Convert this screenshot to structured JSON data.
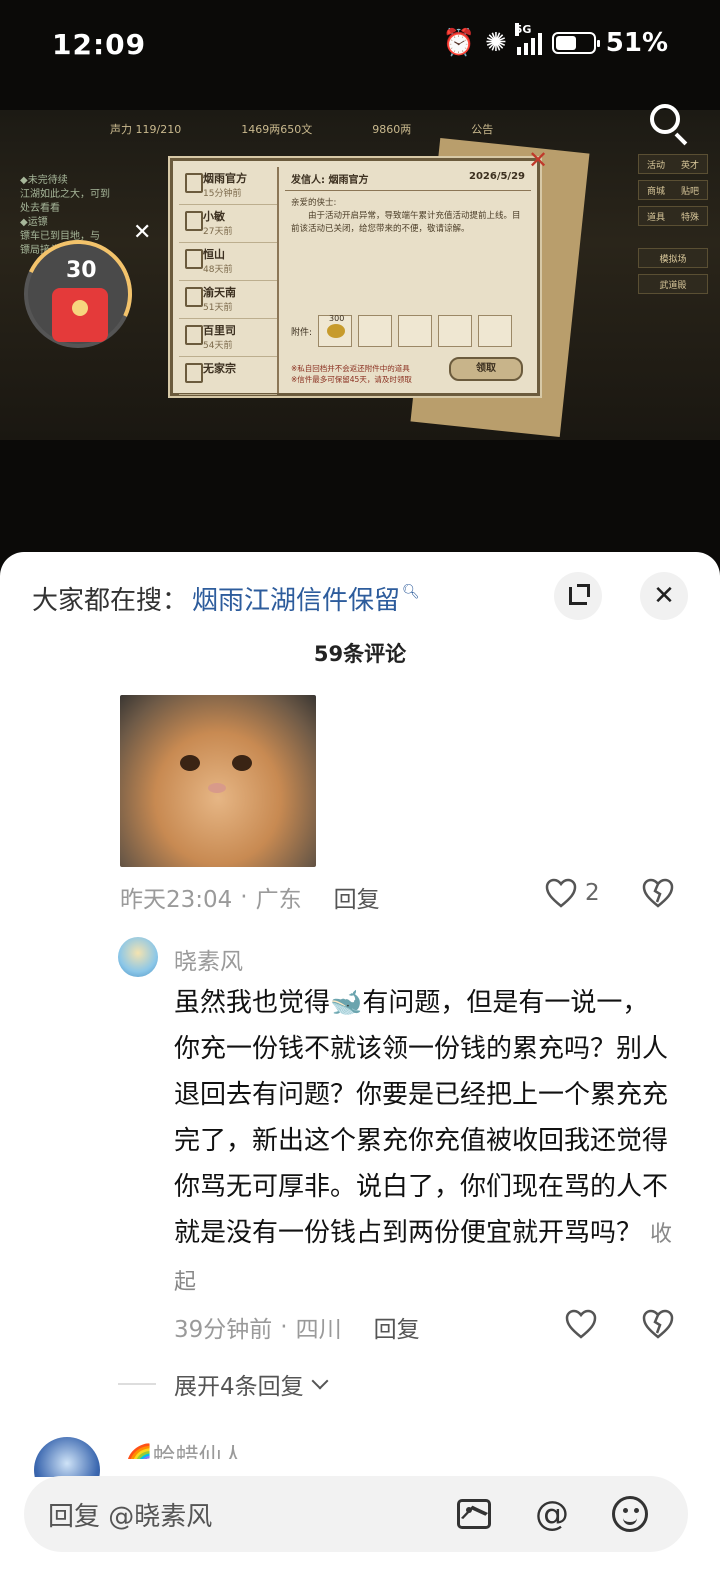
{
  "status_bar": {
    "time": "12:09",
    "network": "5G",
    "battery": "51%"
  },
  "game": {
    "topbar": [
      "声力 119/210",
      "1469两650文",
      "9860两",
      "公告"
    ],
    "left_info": [
      "◆未完待续",
      "江湖如此之大，可到",
      "处去看看",
      "◆运镖",
      "镖车已到目地，与",
      "镖局接头"
    ],
    "right_menu": [
      [
        "活动",
        "英才"
      ],
      [
        "商城",
        "贴吧"
      ],
      [
        "道具",
        "特殊"
      ],
      [
        "模拟场",
        ""
      ],
      [
        "武道殿",
        ""
      ]
    ],
    "mail_list": [
      {
        "name": "烟雨官方",
        "time": "15分钟前"
      },
      {
        "name": "小敏",
        "time": "27天前"
      },
      {
        "name": "恒山",
        "time": "48天前"
      },
      {
        "name": "渝天南",
        "time": "51天前"
      },
      {
        "name": "百里司",
        "time": "54天前"
      },
      {
        "name": "无家宗",
        "time": ""
      }
    ],
    "sender_label": "发信人: 烟雨官方",
    "date": "2026/5/29",
    "greeting": "亲爱的侠士:",
    "body": "由于活动开启异常，导致端午累计充值活动提前上线。目前该活动已关闭，给您带来的不便，敬请谅解。",
    "attachment_label": "附件:",
    "attachment_count": "300",
    "notes": [
      "※私自回档并不会返还附件中的道具",
      "※信件最多可保留45天，请及时领取"
    ],
    "claim_label": "领取",
    "red_envelope_count": "30"
  },
  "sheet": {
    "hot_search_prefix": "大家都在搜：",
    "hot_search_keyword": "烟雨江湖信件保留",
    "comment_count": "59条评论",
    "comment1": {
      "time": "昨天23:04",
      "location": "广东",
      "reply": "回复",
      "likes": "2"
    },
    "comment2": {
      "user": "晓素风",
      "text": "虽然我也觉得🐋有问题，但是有一说一，你充一份钱不就该领一份钱的累充吗？别人退回去有问题？你要是已经把上一个累充充完了，新出这个累充你充值被收回我还觉得你骂无可厚非。说白了，你们现在骂的人不就是没有一份钱占到两份便宜就开骂吗？",
      "fold": "收起",
      "time": "39分钟前",
      "location": "四川",
      "reply": "回复"
    },
    "expand_replies": "展开4条回复",
    "next_user": "🌈蛤蜡仙人",
    "input_placeholder": "回复 @晓素风"
  }
}
